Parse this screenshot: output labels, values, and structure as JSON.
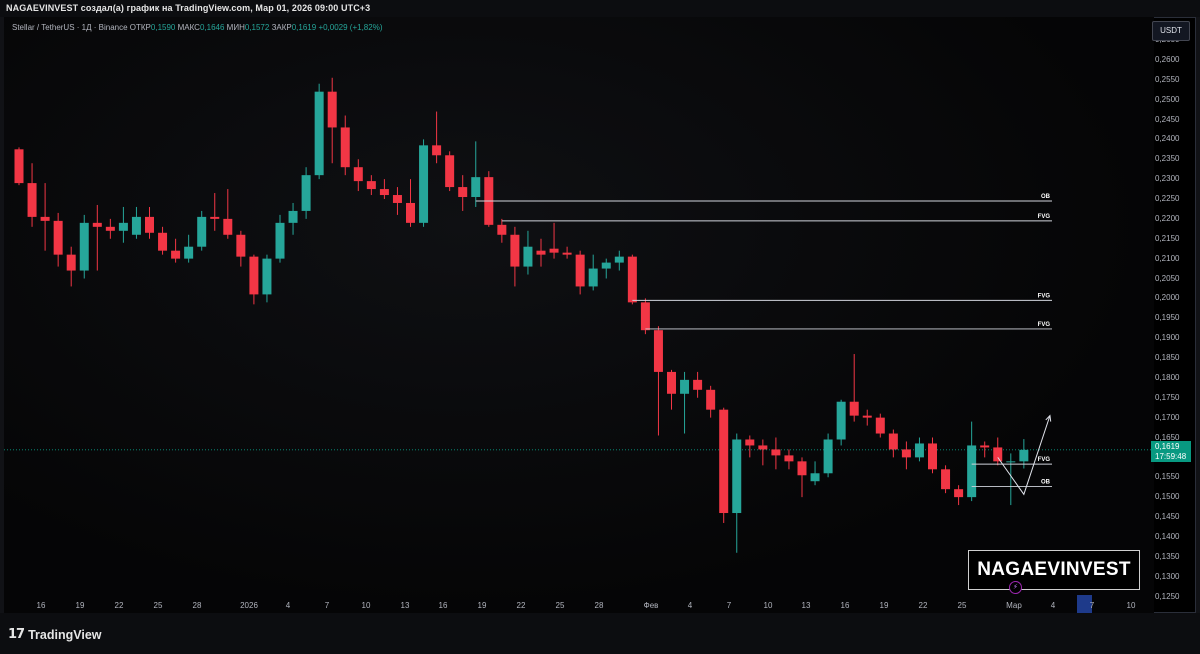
{
  "header": {
    "title": "NAGAEVINVEST создал(а) график на TradingView.com, Мар 01, 2026 09:00 UTC+3"
  },
  "legend": {
    "symbol": "Stellar / TetherUS · 1Д · Binance",
    "open_label": "ОТКР",
    "open": "0,1590",
    "high_label": "МАКС",
    "high": "0,1646",
    "low_label": "МИН",
    "low": "0,1572",
    "close_label": "ЗАКР",
    "close": "0,1619",
    "change": "+0,0029 (+1,82%)"
  },
  "price_axis": {
    "currency": "USDT",
    "ticks": [
      "0,2650",
      "0,2600",
      "0,2550",
      "0,2500",
      "0,2450",
      "0,2400",
      "0,2350",
      "0,2300",
      "0,2250",
      "0,2200",
      "0,2150",
      "0,2100",
      "0,2050",
      "0,2000",
      "0,1950",
      "0,1900",
      "0,1850",
      "0,1800",
      "0,1750",
      "0,1700",
      "0,1650",
      "0,1600",
      "0,1550",
      "0,1500",
      "0,1450",
      "0,1400",
      "0,1350",
      "0,1300",
      "0,1250"
    ],
    "last_price": "0,1619",
    "countdown": "17:59:48"
  },
  "time_axis": {
    "labels": [
      "16",
      "19",
      "22",
      "25",
      "28",
      "2026",
      "4",
      "7",
      "10",
      "13",
      "16",
      "19",
      "22",
      "25",
      "28",
      "Фев",
      "4",
      "7",
      "10",
      "13",
      "16",
      "19",
      "22",
      "25",
      "Мар",
      "4",
      "7",
      "10"
    ]
  },
  "annotations": {
    "levels": [
      {
        "label": "OB",
        "price": 0.2245
      },
      {
        "label": "FVG",
        "price": 0.2195
      },
      {
        "label": "FVG",
        "price": 0.1995
      },
      {
        "label": "FVG",
        "price": 0.1923
      },
      {
        "label": "FVG",
        "price": 0.1583
      },
      {
        "label": "OB",
        "price": 0.1527
      }
    ]
  },
  "watermark": "NAGAEVINVEST",
  "footer": {
    "brand": "TradingView"
  },
  "colors": {
    "up": "#26a69a",
    "down": "#f23645",
    "background": "#000000",
    "last_price": "#089981"
  },
  "chart_data": {
    "type": "candlestick",
    "symbol": "XLMUSDT",
    "timeframe": "1D",
    "candles": [
      {
        "date": "2025-12-14",
        "o": 0.2375,
        "h": 0.238,
        "l": 0.2285,
        "c": 0.229
      },
      {
        "date": "2025-12-15",
        "o": 0.229,
        "h": 0.234,
        "l": 0.218,
        "c": 0.2205
      },
      {
        "date": "2025-12-16",
        "o": 0.2205,
        "h": 0.229,
        "l": 0.212,
        "c": 0.2195
      },
      {
        "date": "2025-12-17",
        "o": 0.2195,
        "h": 0.2215,
        "l": 0.208,
        "c": 0.211
      },
      {
        "date": "2025-12-18",
        "o": 0.211,
        "h": 0.213,
        "l": 0.203,
        "c": 0.207
      },
      {
        "date": "2025-12-19",
        "o": 0.207,
        "h": 0.221,
        "l": 0.205,
        "c": 0.219
      },
      {
        "date": "2025-12-20",
        "o": 0.219,
        "h": 0.2235,
        "l": 0.207,
        "c": 0.218
      },
      {
        "date": "2025-12-21",
        "o": 0.218,
        "h": 0.22,
        "l": 0.215,
        "c": 0.217
      },
      {
        "date": "2025-12-22",
        "o": 0.217,
        "h": 0.223,
        "l": 0.214,
        "c": 0.219
      },
      {
        "date": "2025-12-23",
        "o": 0.216,
        "h": 0.223,
        "l": 0.215,
        "c": 0.2205
      },
      {
        "date": "2025-12-24",
        "o": 0.2205,
        "h": 0.223,
        "l": 0.215,
        "c": 0.2165
      },
      {
        "date": "2025-12-25",
        "o": 0.2165,
        "h": 0.218,
        "l": 0.211,
        "c": 0.212
      },
      {
        "date": "2025-12-26",
        "o": 0.212,
        "h": 0.215,
        "l": 0.209,
        "c": 0.21
      },
      {
        "date": "2025-12-27",
        "o": 0.21,
        "h": 0.216,
        "l": 0.209,
        "c": 0.213
      },
      {
        "date": "2025-12-28",
        "o": 0.213,
        "h": 0.222,
        "l": 0.212,
        "c": 0.2205
      },
      {
        "date": "2025-12-29",
        "o": 0.2205,
        "h": 0.2265,
        "l": 0.217,
        "c": 0.22
      },
      {
        "date": "2025-12-30",
        "o": 0.22,
        "h": 0.2275,
        "l": 0.215,
        "c": 0.216
      },
      {
        "date": "2025-12-31",
        "o": 0.216,
        "h": 0.217,
        "l": 0.208,
        "c": 0.2105
      },
      {
        "date": "2026-01-01",
        "o": 0.2105,
        "h": 0.211,
        "l": 0.1985,
        "c": 0.201
      },
      {
        "date": "2026-01-02",
        "o": 0.201,
        "h": 0.211,
        "l": 0.199,
        "c": 0.21
      },
      {
        "date": "2026-01-03",
        "o": 0.21,
        "h": 0.221,
        "l": 0.209,
        "c": 0.219
      },
      {
        "date": "2026-01-04",
        "o": 0.219,
        "h": 0.224,
        "l": 0.216,
        "c": 0.222
      },
      {
        "date": "2026-01-05",
        "o": 0.222,
        "h": 0.233,
        "l": 0.22,
        "c": 0.231
      },
      {
        "date": "2026-01-06",
        "o": 0.231,
        "h": 0.254,
        "l": 0.23,
        "c": 0.252
      },
      {
        "date": "2026-01-07",
        "o": 0.252,
        "h": 0.2555,
        "l": 0.234,
        "c": 0.243
      },
      {
        "date": "2026-01-08",
        "o": 0.243,
        "h": 0.246,
        "l": 0.231,
        "c": 0.233
      },
      {
        "date": "2026-01-09",
        "o": 0.233,
        "h": 0.235,
        "l": 0.227,
        "c": 0.2295
      },
      {
        "date": "2026-01-10",
        "o": 0.2295,
        "h": 0.231,
        "l": 0.226,
        "c": 0.2275
      },
      {
        "date": "2026-01-11",
        "o": 0.2275,
        "h": 0.23,
        "l": 0.225,
        "c": 0.226
      },
      {
        "date": "2026-01-12",
        "o": 0.226,
        "h": 0.228,
        "l": 0.221,
        "c": 0.224
      },
      {
        "date": "2026-01-13",
        "o": 0.224,
        "h": 0.23,
        "l": 0.218,
        "c": 0.219
      },
      {
        "date": "2026-01-14",
        "o": 0.219,
        "h": 0.24,
        "l": 0.218,
        "c": 0.2385
      },
      {
        "date": "2026-01-15",
        "o": 0.2385,
        "h": 0.247,
        "l": 0.234,
        "c": 0.236
      },
      {
        "date": "2026-01-16",
        "o": 0.236,
        "h": 0.237,
        "l": 0.227,
        "c": 0.228
      },
      {
        "date": "2026-01-17",
        "o": 0.228,
        "h": 0.231,
        "l": 0.222,
        "c": 0.2255
      },
      {
        "date": "2026-01-18",
        "o": 0.2255,
        "h": 0.2395,
        "l": 0.223,
        "c": 0.2305
      },
      {
        "date": "2026-01-19",
        "o": 0.2305,
        "h": 0.232,
        "l": 0.218,
        "c": 0.2185
      },
      {
        "date": "2026-01-20",
        "o": 0.2185,
        "h": 0.22,
        "l": 0.214,
        "c": 0.216
      },
      {
        "date": "2026-01-21",
        "o": 0.216,
        "h": 0.218,
        "l": 0.203,
        "c": 0.208
      },
      {
        "date": "2026-01-22",
        "o": 0.208,
        "h": 0.217,
        "l": 0.206,
        "c": 0.213
      },
      {
        "date": "2026-01-23",
        "o": 0.212,
        "h": 0.215,
        "l": 0.208,
        "c": 0.211
      },
      {
        "date": "2026-01-24",
        "o": 0.2125,
        "h": 0.219,
        "l": 0.21,
        "c": 0.2115
      },
      {
        "date": "2026-01-25",
        "o": 0.2115,
        "h": 0.213,
        "l": 0.21,
        "c": 0.211
      },
      {
        "date": "2026-01-26",
        "o": 0.211,
        "h": 0.212,
        "l": 0.201,
        "c": 0.203
      },
      {
        "date": "2026-01-27",
        "o": 0.203,
        "h": 0.211,
        "l": 0.202,
        "c": 0.2075
      },
      {
        "date": "2026-01-28",
        "o": 0.2075,
        "h": 0.21,
        "l": 0.205,
        "c": 0.209
      },
      {
        "date": "2026-01-29",
        "o": 0.209,
        "h": 0.212,
        "l": 0.207,
        "c": 0.2105
      },
      {
        "date": "2026-01-30",
        "o": 0.2105,
        "h": 0.211,
        "l": 0.1985,
        "c": 0.199
      },
      {
        "date": "2026-01-31",
        "o": 0.199,
        "h": 0.2,
        "l": 0.191,
        "c": 0.192
      },
      {
        "date": "2026-02-01",
        "o": 0.192,
        "h": 0.193,
        "l": 0.1655,
        "c": 0.1815
      },
      {
        "date": "2026-02-02",
        "o": 0.1815,
        "h": 0.182,
        "l": 0.172,
        "c": 0.176
      },
      {
        "date": "2026-02-03",
        "o": 0.176,
        "h": 0.1815,
        "l": 0.166,
        "c": 0.1795
      },
      {
        "date": "2026-02-04",
        "o": 0.1795,
        "h": 0.1815,
        "l": 0.175,
        "c": 0.177
      },
      {
        "date": "2026-02-05",
        "o": 0.177,
        "h": 0.178,
        "l": 0.17,
        "c": 0.172
      },
      {
        "date": "2026-02-06",
        "o": 0.172,
        "h": 0.1725,
        "l": 0.1435,
        "c": 0.146
      },
      {
        "date": "2026-02-07",
        "o": 0.146,
        "h": 0.166,
        "l": 0.136,
        "c": 0.1645
      },
      {
        "date": "2026-02-08",
        "o": 0.1645,
        "h": 0.1655,
        "l": 0.16,
        "c": 0.163
      },
      {
        "date": "2026-02-09",
        "o": 0.163,
        "h": 0.1645,
        "l": 0.158,
        "c": 0.162
      },
      {
        "date": "2026-02-10",
        "o": 0.162,
        "h": 0.165,
        "l": 0.157,
        "c": 0.1605
      },
      {
        "date": "2026-02-11",
        "o": 0.1605,
        "h": 0.162,
        "l": 0.157,
        "c": 0.159
      },
      {
        "date": "2026-02-12",
        "o": 0.159,
        "h": 0.16,
        "l": 0.15,
        "c": 0.1555
      },
      {
        "date": "2026-02-13",
        "o": 0.154,
        "h": 0.159,
        "l": 0.153,
        "c": 0.156
      },
      {
        "date": "2026-02-14",
        "o": 0.156,
        "h": 0.166,
        "l": 0.155,
        "c": 0.1645
      },
      {
        "date": "2026-02-15",
        "o": 0.1645,
        "h": 0.1745,
        "l": 0.163,
        "c": 0.174
      },
      {
        "date": "2026-02-16",
        "o": 0.174,
        "h": 0.186,
        "l": 0.169,
        "c": 0.1705
      },
      {
        "date": "2026-02-17",
        "o": 0.1705,
        "h": 0.172,
        "l": 0.168,
        "c": 0.17
      },
      {
        "date": "2026-02-18",
        "o": 0.17,
        "h": 0.171,
        "l": 0.165,
        "c": 0.166
      },
      {
        "date": "2026-02-19",
        "o": 0.166,
        "h": 0.167,
        "l": 0.16,
        "c": 0.162
      },
      {
        "date": "2026-02-20",
        "o": 0.162,
        "h": 0.164,
        "l": 0.157,
        "c": 0.16
      },
      {
        "date": "2026-02-21",
        "o": 0.16,
        "h": 0.165,
        "l": 0.159,
        "c": 0.1635
      },
      {
        "date": "2026-02-22",
        "o": 0.1635,
        "h": 0.165,
        "l": 0.156,
        "c": 0.157
      },
      {
        "date": "2026-02-23",
        "o": 0.157,
        "h": 0.158,
        "l": 0.151,
        "c": 0.152
      },
      {
        "date": "2026-02-24",
        "o": 0.152,
        "h": 0.153,
        "l": 0.148,
        "c": 0.15
      },
      {
        "date": "2026-02-25",
        "o": 0.15,
        "h": 0.169,
        "l": 0.149,
        "c": 0.163
      },
      {
        "date": "2026-02-26",
        "o": 0.163,
        "h": 0.164,
        "l": 0.16,
        "c": 0.1625
      },
      {
        "date": "2026-02-27",
        "o": 0.1625,
        "h": 0.165,
        "l": 0.158,
        "c": 0.159
      },
      {
        "date": "2026-02-28",
        "o": 0.159,
        "h": 0.161,
        "l": 0.148,
        "c": 0.159
      },
      {
        "date": "2026-03-01",
        "o": 0.159,
        "h": 0.1646,
        "l": 0.1572,
        "c": 0.1619
      }
    ],
    "projection": [
      {
        "date": "2026-02-27",
        "price": 0.16
      },
      {
        "date": "2026-03-01",
        "price": 0.1507
      },
      {
        "date": "2026-03-03",
        "price": 0.1705
      }
    ]
  }
}
